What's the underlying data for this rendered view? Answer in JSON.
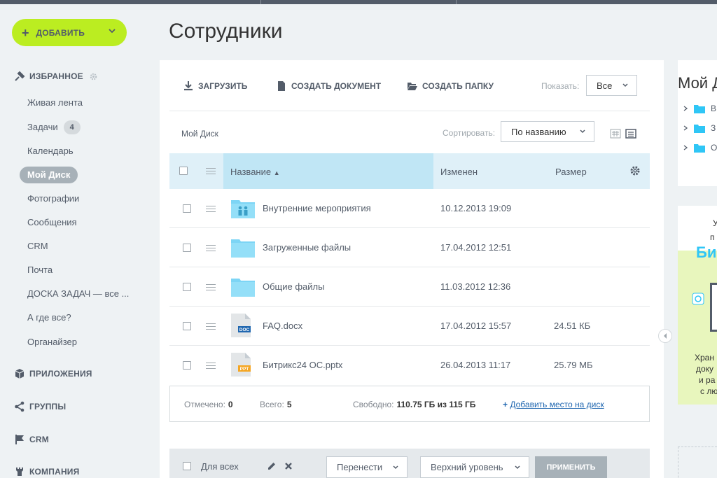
{
  "sidebar": {
    "add_button": "ДОБАВИТЬ",
    "favorites": "ИЗБРАННОЕ",
    "items": [
      {
        "label": "Живая лента"
      },
      {
        "label": "Задачи",
        "badge": "4"
      },
      {
        "label": "Календарь"
      },
      {
        "label": "Мой Диск",
        "active": true
      },
      {
        "label": "Фотографии"
      },
      {
        "label": "Сообщения"
      },
      {
        "label": "CRM"
      },
      {
        "label": "Почта"
      },
      {
        "label": "ДОСКА ЗАДАЧ — все ..."
      },
      {
        "label": "А где все?"
      },
      {
        "label": "Органайзер"
      }
    ],
    "sections": {
      "apps": "ПРИЛОЖЕНИЯ",
      "groups": "ГРУППЫ",
      "crm": "CRM",
      "company": "КОМПАНИЯ"
    }
  },
  "header": {
    "title": "Сотрудники"
  },
  "toolbar": {
    "upload": "ЗАГРУЗИТЬ",
    "create_doc": "СОЗДАТЬ ДОКУМЕНТ",
    "create_folder": "СОЗДАТЬ ПАПКУ",
    "show_label": "Показать:",
    "show_value": "Все"
  },
  "subbar": {
    "breadcrumb": "Мой Диск",
    "sort_label": "Сортировать:",
    "sort_value": "По названию"
  },
  "table": {
    "columns": {
      "name": "Название",
      "modified": "Изменен",
      "size": "Размер"
    },
    "rows": [
      {
        "name": "Внутренние мероприятия",
        "modified": "10.12.2013 19:09",
        "size": "",
        "type": "folder-shared"
      },
      {
        "name": "Загруженные файлы",
        "modified": "17.04.2012 12:51",
        "size": "",
        "type": "folder"
      },
      {
        "name": "Общие файлы",
        "modified": "11.03.2012 12:36",
        "size": "",
        "type": "folder"
      },
      {
        "name": "FAQ.docx",
        "modified": "17.04.2012 15:57",
        "size": "24.51 КБ",
        "type": "doc",
        "ext": "DOC"
      },
      {
        "name": "Битрикс24 ОС.pptx",
        "modified": "26.04.2013 11:17",
        "size": "25.79 МБ",
        "type": "ppt",
        "ext": "PPT"
      }
    ]
  },
  "summary": {
    "selected_label": "Отмечено:",
    "selected_value": "0",
    "total_label": "Всего:",
    "total_value": "5",
    "free_label": "Свободно:",
    "free_value": "110.75 ГБ из 115 ГБ",
    "add_space": "Добавить место на диск",
    "add_space_prefix": "+"
  },
  "footer": {
    "for_all": "Для всех",
    "move": "Перенести",
    "level": "Верхний уровень",
    "apply": "ПРИМЕНИТЬ"
  },
  "right_panel": {
    "title": "Мой Д",
    "tree": [
      "В",
      "З",
      "О"
    ],
    "promo_lines": [
      "У",
      "п",
      "Хран",
      "доку",
      "и ра",
      "с лю"
    ],
    "promo_brand": "Би"
  },
  "colors": {
    "accent_green": "#bbed21",
    "header_blue": "#c0e6f5",
    "folder_blue": "#7dd5f5",
    "link_blue": "#2067b0"
  }
}
